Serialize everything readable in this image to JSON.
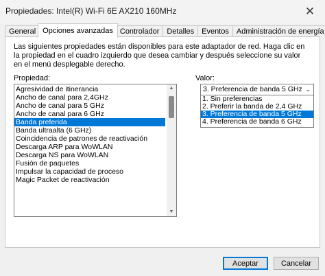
{
  "window": {
    "title": "Propiedades: Intel(R) Wi-Fi 6E AX210 160MHz",
    "close_glyph": "✕"
  },
  "tabs": [
    {
      "label": "General",
      "active": false
    },
    {
      "label": "Opciones avanzadas",
      "active": true
    },
    {
      "label": "Controlador",
      "active": false
    },
    {
      "label": "Detalles",
      "active": false
    },
    {
      "label": "Eventos",
      "active": false
    },
    {
      "label": "Administración de energía",
      "active": false
    }
  ],
  "panel": {
    "description": "Las siguientes propiedades están disponibles para este adaptador de red. Haga clic en la propiedad en el cuadro izquierdo que desea cambiar y después seleccione su valor en el menú desplegable derecho.",
    "property_label": "Propiedad:",
    "value_label": "Valor:",
    "properties": [
      "Agresividad de itinerancia",
      "Ancho de canal para 2,4GHz",
      "Ancho de canal para 5 GHz",
      "Ancho de canal para 6 GHz",
      "Banda preferida",
      "Banda ultraalta (6 GHz)",
      "Coincidencia de patrones de reactivación",
      "Descarga ARP para WoWLAN",
      "Descarga NS para WoWLAN",
      "Fusión de paquetes",
      "Impulsar la capacidad de proceso",
      "Magic Packet de reactivación"
    ],
    "selected_property_index": 4,
    "value_selected": "3. Preferencia de banda 5 GHz",
    "value_options": [
      "1. Sin preferencias",
      "2. Preferir la banda de 2,4 GHz",
      "3. Preferencia de banda 5 GHz",
      "4. Preferencia de banda 6 GHz"
    ],
    "selected_value_index": 2
  },
  "buttons": {
    "ok": "Aceptar",
    "cancel": "Cancelar"
  },
  "icons": {
    "close": "close-icon",
    "scroll_up": "scroll-up-arrow-icon",
    "scroll_down": "scroll-down-arrow-icon",
    "combo_arrow": "chevron-down-icon"
  },
  "colors": {
    "selection": "#0078d7",
    "panel_bg": "#ffffff",
    "window_bg": "#f0f0f0"
  }
}
